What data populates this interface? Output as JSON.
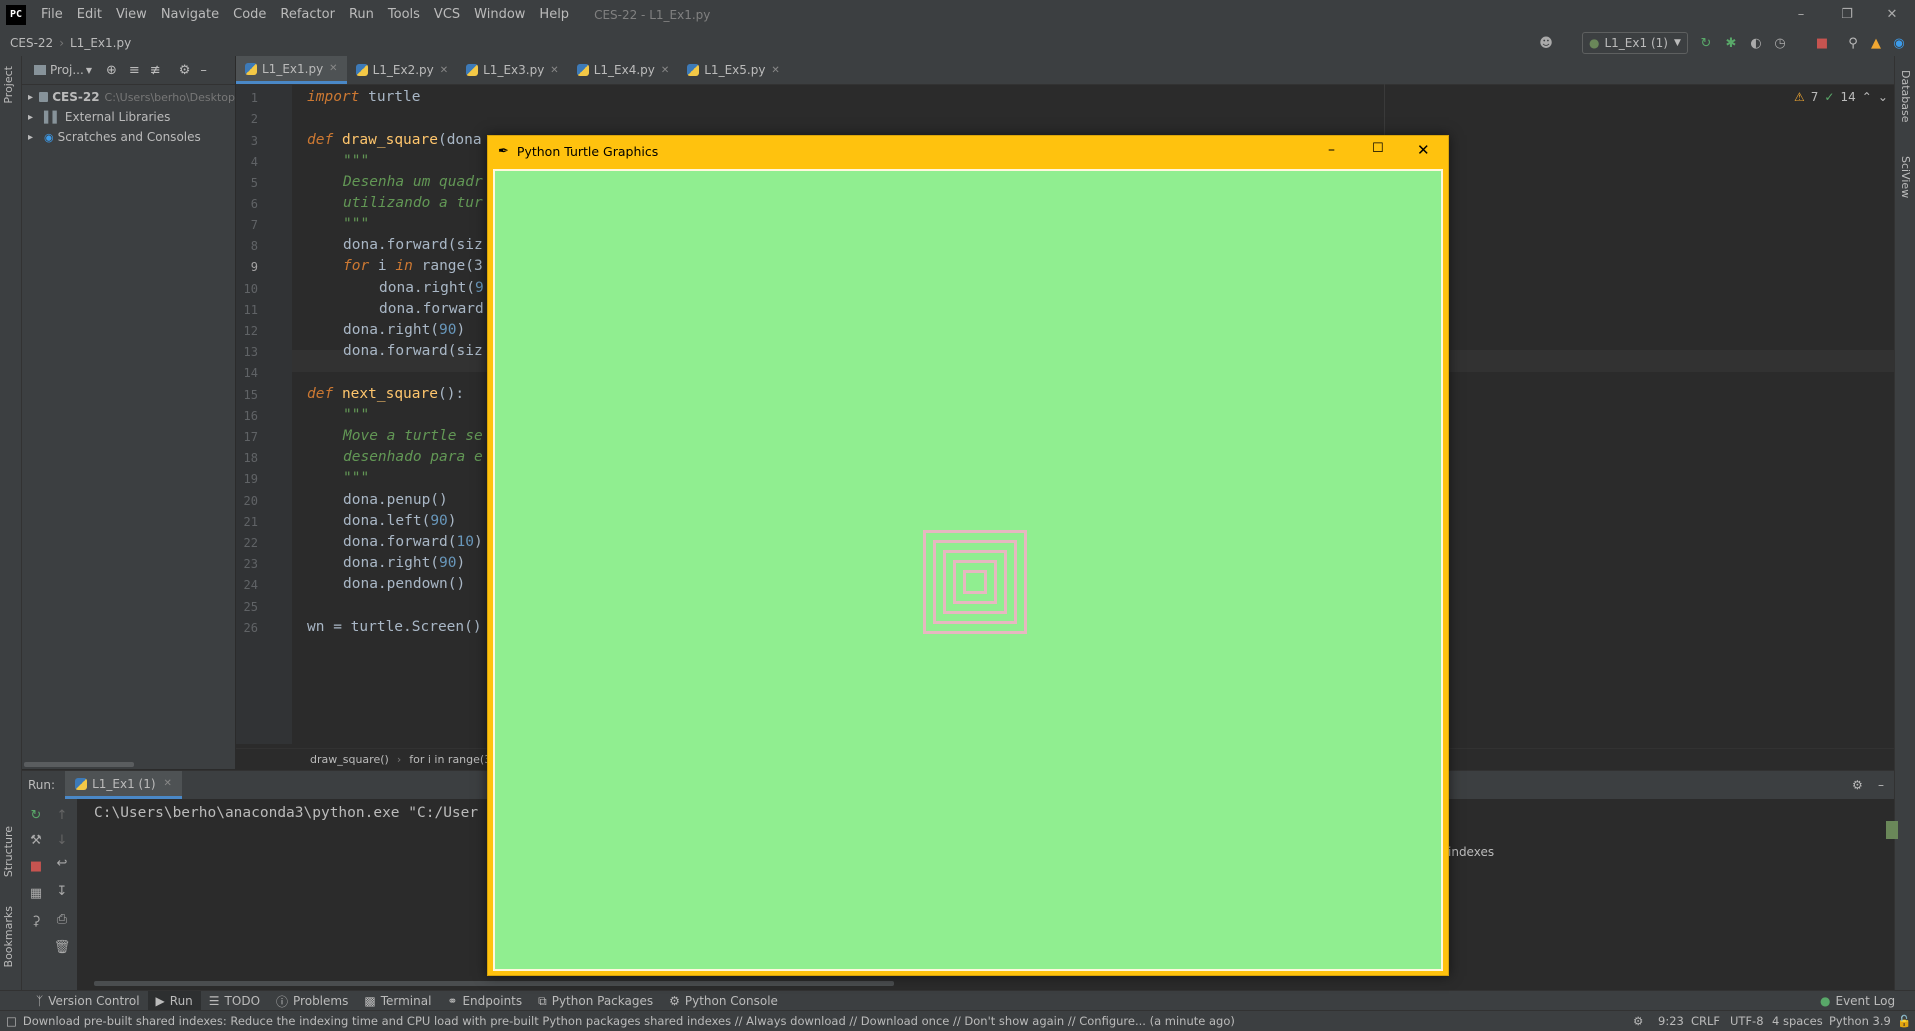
{
  "titlebar": {
    "logo": "PC",
    "menu": [
      "File",
      "Edit",
      "View",
      "Navigate",
      "Code",
      "Refactor",
      "Run",
      "Tools",
      "VCS",
      "Window",
      "Help"
    ],
    "window_title": "CES-22 - L1_Ex1.py"
  },
  "navbar": {
    "project": "CES-22",
    "file": "L1_Ex1.py",
    "run_config": "L1_Ex1 (1)"
  },
  "left_stripe": {
    "project_tab": "Project",
    "structure_tab": "Structure",
    "bookmarks_tab": "Bookmarks"
  },
  "right_stripe": {
    "database_tab": "Database",
    "sciview_tab": "SciView"
  },
  "project_panel": {
    "title": "Proj...",
    "items": [
      {
        "label": "CES-22",
        "path": "C:\\Users\\berho\\Desktop"
      },
      {
        "label": "External Libraries"
      },
      {
        "label": "Scratches and Consoles"
      }
    ]
  },
  "editor": {
    "tabs": [
      "L1_Ex1.py",
      "L1_Ex2.py",
      "L1_Ex3.py",
      "L1_Ex4.py",
      "L1_Ex5.py"
    ],
    "warnings": "7",
    "ok": "14",
    "line_numbers": [
      "1",
      "2",
      "3",
      "4",
      "5",
      "6",
      "7",
      "8",
      "9",
      "10",
      "11",
      "12",
      "13",
      "14",
      "15",
      "16",
      "17",
      "18",
      "19",
      "20",
      "21",
      "22",
      "23",
      "24",
      "25",
      "26"
    ],
    "code": {
      "l1_kw": "import",
      "l1_rest": " turtle",
      "l3_kw": "def",
      "l3_fn": "draw_square",
      "l3_rest": "(dona",
      "l4": "\"\"\"",
      "l5": "Desenha um quadr",
      "l6": "utilizando a tur",
      "l7": "\"\"\"",
      "l8": "dona.forward(siz",
      "l9_kw1": "for",
      "l9_a": " i ",
      "l9_kw2": "in",
      "l9_b": " range(3",
      "l10_a": "dona.right(",
      "l10_n": "9",
      "l11": "dona.forward",
      "l12_a": "dona.right(",
      "l12_n": "90",
      "l12_b": ")",
      "l13": "dona.forward(siz",
      "l15_kw": "def",
      "l15_fn": "next_square",
      "l15_rest": "():",
      "l16": "\"\"\"",
      "l17": "Move a turtle se",
      "l18": "desenhado para e",
      "l19": "\"\"\"",
      "l20": "dona.penup()",
      "l21_a": "dona.left(",
      "l21_n": "90",
      "l21_b": ")",
      "l22_a": "dona.forward(",
      "l22_n": "10",
      "l22_b": ")",
      "l23_a": "dona.right(",
      "l23_n": "90",
      "l23_b": ")",
      "l24": "dona.pendown()",
      "l26": "wn = turtle.Screen()"
    },
    "breadcrumbs": [
      "draw_square()",
      "for i in range(3"
    ]
  },
  "run_panel": {
    "label": "Run:",
    "tab": "L1_Ex1 (1)",
    "console_line": "C:\\Users\\berho\\anaconda3\\python.exe \"C:/User",
    "index_hint": "indexes"
  },
  "toolwindows": [
    "Version Control",
    "Run",
    "TODO",
    "Problems",
    "Terminal",
    "Endpoints",
    "Python Packages",
    "Python Console"
  ],
  "event_log": "Event Log",
  "statusbar": {
    "message": "Download pre-built shared indexes: Reduce the indexing time and CPU load with pre-built Python packages shared indexes // Always download // Download once // Don't show again // Configure... (a minute ago)",
    "position": "9:23",
    "line_sep": "CRLF",
    "encoding": "UTF-8",
    "indent": "4 spaces",
    "interpreter": "Python 3.9"
  },
  "turtle_window": {
    "title": "Python Turtle Graphics",
    "canvas_color": "#90ee90",
    "square_color": "#e7b7c0",
    "titlebar_color": "#ffc20e"
  }
}
